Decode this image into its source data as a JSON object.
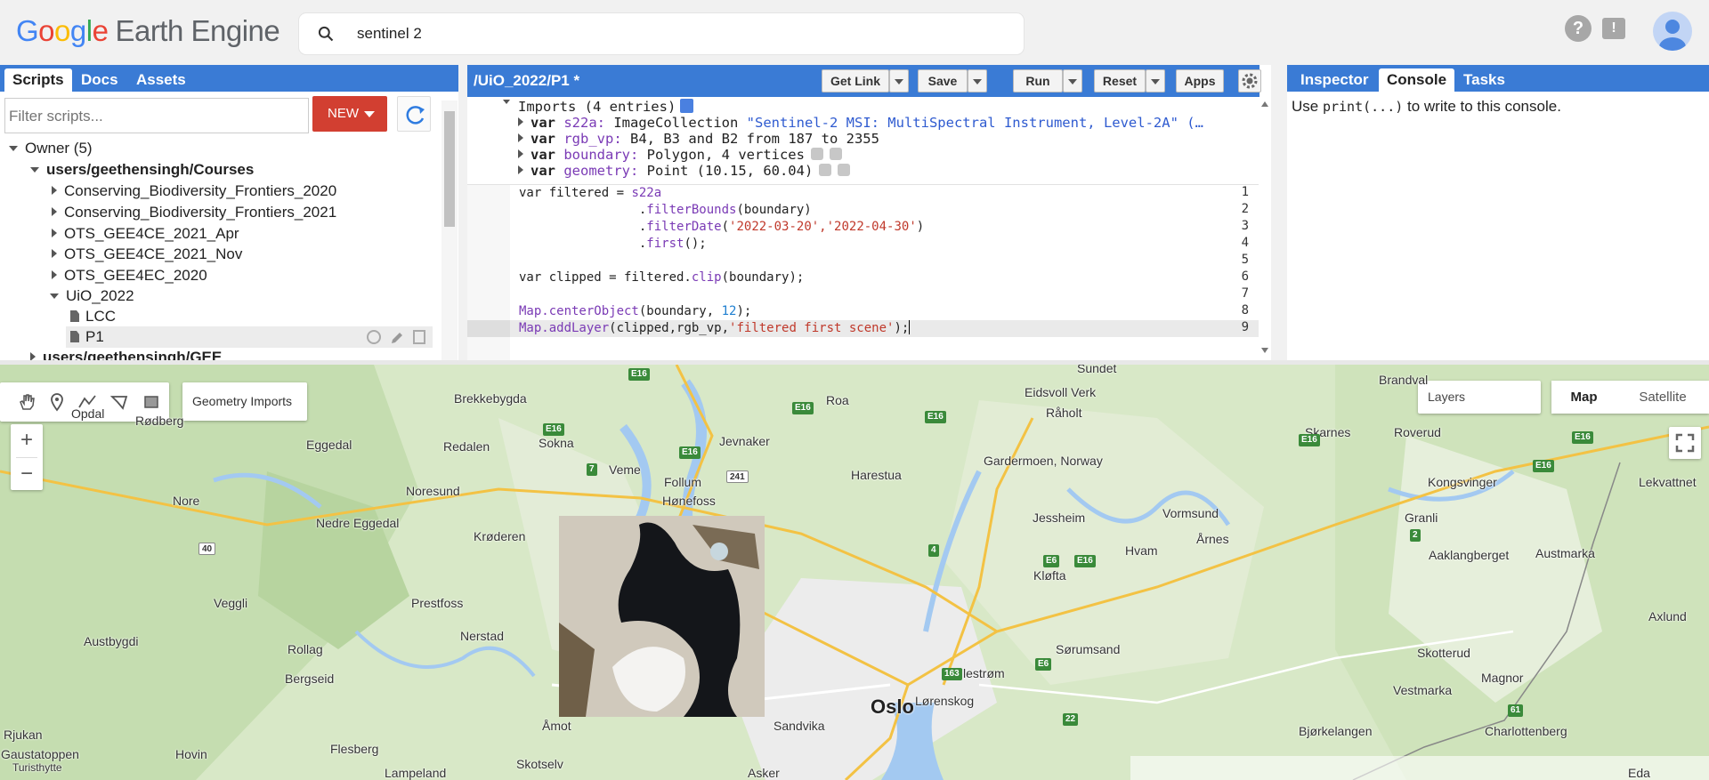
{
  "header": {
    "logo_letters": [
      "G",
      "o",
      "o",
      "g",
      "l",
      "e"
    ],
    "logo_product": "Earth Engine",
    "search_value": "sentinel 2",
    "help_icon": "help-icon",
    "feedback_icon": "feedback-icon",
    "avatar_icon": "account-avatar"
  },
  "left_panel": {
    "tabs": [
      {
        "label": "Scripts"
      },
      {
        "label": "Docs"
      },
      {
        "label": "Assets"
      }
    ],
    "filter_placeholder": "Filter scripts...",
    "new_label": "NEW",
    "tree": [
      {
        "label": "Owner (5)"
      },
      {
        "label": "users/geethensingh/Courses"
      },
      {
        "label": "Conserving_Biodiversity_Frontiers_2020"
      },
      {
        "label": "Conserving_Biodiversity_Frontiers_2021"
      },
      {
        "label": "OTS_GEE4CE_2021_Apr"
      },
      {
        "label": "OTS_GEE4CE_2021_Nov"
      },
      {
        "label": "OTS_GEE4EC_2020"
      },
      {
        "label": "UiO_2022"
      },
      {
        "label": "LCC"
      },
      {
        "label": "P1"
      },
      {
        "label": "users/geethensingh/GEE"
      }
    ]
  },
  "editor": {
    "title": "/UiO_2022/P1 *",
    "buttons": {
      "get_link": "Get Link",
      "save": "Save",
      "run": "Run",
      "reset": "Reset",
      "apps": "Apps"
    },
    "imports_header": "Imports (4 entries)",
    "imports": [
      {
        "kw": "var",
        "name": "s22a",
        "text": "ImageCollection",
        "detail": "\"Sentinel-2 MSI: MultiSpectral Instrument, Level-2A\" (…"
      },
      {
        "kw": "var",
        "name": "rgb_vp",
        "text": "B4, B3 and B2 from 187 to 2355",
        "detail": ""
      },
      {
        "kw": "var",
        "name": "boundary",
        "text": "Polygon, 4 vertices",
        "detail": ""
      },
      {
        "kw": "var",
        "name": "geometry",
        "text": "Point (10.15, 60.04)",
        "detail": ""
      }
    ],
    "line_numbers": [
      "1",
      "2",
      "3",
      "4",
      "5",
      "6",
      "7",
      "8",
      "9"
    ],
    "code": [
      {
        "p1": "var filtered = ",
        "fn": "s22a",
        "p2": "",
        "s": "",
        "p3": ""
      },
      {
        "p1": "                .",
        "fn": "filterBounds",
        "p2": "(boundary)",
        "s": "",
        "p3": ""
      },
      {
        "p1": "                .",
        "fn": "filterDate",
        "p2": "(",
        "s": "'2022-03-20','2022-04-30'",
        "p3": ")"
      },
      {
        "p1": "                .",
        "fn": "first",
        "p2": "();",
        "s": "",
        "p3": ""
      },
      {
        "p1": "",
        "fn": "",
        "p2": "",
        "s": "",
        "p3": ""
      },
      {
        "p1": "var clipped = filtered.",
        "fn": "clip",
        "p2": "(boundary);",
        "s": "",
        "p3": ""
      },
      {
        "p1": "",
        "fn": "",
        "p2": "",
        "s": "",
        "p3": ""
      },
      {
        "p1": "",
        "fn": "Map.centerObject",
        "p2": "(boundary, ",
        "s": "12",
        "p3": ");"
      },
      {
        "p1": "",
        "fn": "Map.addLayer",
        "p2": "(clipped,rgb_vp,",
        "s": "'filtered first scene'",
        "p3": ");"
      }
    ]
  },
  "right_panel": {
    "tabs": [
      {
        "label": "Inspector"
      },
      {
        "label": "Console"
      },
      {
        "label": "Tasks"
      }
    ],
    "console_pre": "Use ",
    "console_code": "print(...)",
    "console_post": " to write to this console."
  },
  "map": {
    "geometry_imports": "Geometry Imports",
    "layers": "Layers",
    "maptype": {
      "map": "Map",
      "satellite": "Satellite"
    },
    "zoom_in": "+",
    "zoom_out": "−",
    "places": [
      "Opdal",
      "Rødberg",
      "Brekkebygda",
      "Sokna",
      "Jevnaker",
      "Roa",
      "Eidsvoll Verk",
      "Råholt",
      "Brandval",
      "Sundet",
      "Eggedal",
      "Redalen",
      "Veme",
      "Follum",
      "Hønefoss",
      "Harestua",
      "Gardermoen, Norway",
      "Skarnes",
      "Roverud",
      "Kongsvinger",
      "Lekvattnet",
      "Nore",
      "Noresund",
      "Nedre Eggedal",
      "Krøderen",
      "Jessheim",
      "Vormsund",
      "Årnes",
      "Hvam",
      "Granli",
      "Aaklangberget",
      "Austmarka",
      "Kløfta",
      "Veggli",
      "Prestfoss",
      "Nerstad",
      "Austbygdi",
      "Rollag",
      "Bergseid",
      "Sørumsand",
      "Skotterud",
      "Axlund",
      "Lillestrøm",
      "Magnor",
      "Vestmarka",
      "Lørenskog",
      "Oslo",
      "Åmot",
      "Sandvika",
      "Bjørkelangen",
      "Charlottenberg",
      "Rjukan",
      "Gaustatoppen",
      "Hovin",
      "Flesberg",
      "Lampeland",
      "Skotselv",
      "Asker",
      "Eda",
      "Turisthytte"
    ],
    "roads": [
      "E16",
      "E16",
      "E16",
      "E16",
      "E16",
      "E16",
      "E16",
      "E16",
      "E16",
      "7",
      "241",
      "40",
      "4",
      "E6",
      "E6",
      "163",
      "22",
      "2",
      "61"
    ]
  }
}
